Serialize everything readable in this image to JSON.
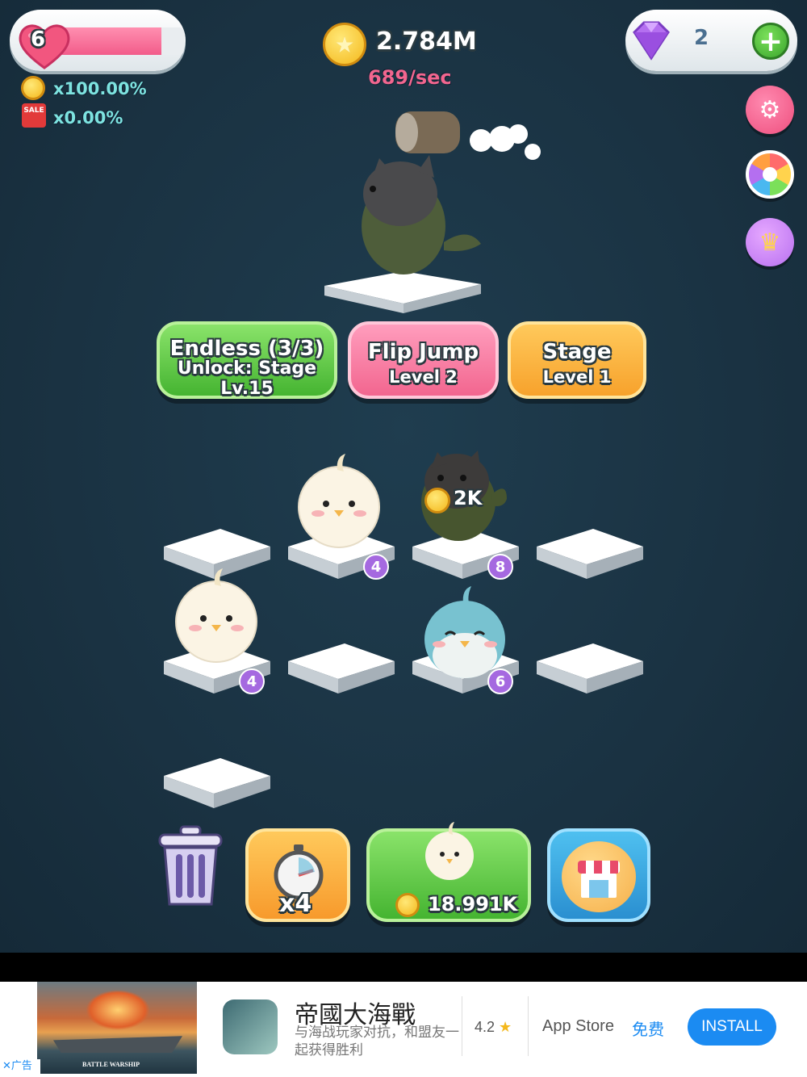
{
  "hud": {
    "lives": "6",
    "lives_fill": 0.82,
    "coins": "2.784M",
    "rate": "689/sec",
    "gems": "2",
    "coin_multiplier": "x100.00%",
    "sale_multiplier": "x0.00%",
    "sale_badge": "SALE"
  },
  "modes": {
    "endless": {
      "line1": "Endless (3/3)",
      "line2": "Unlock: Stage",
      "line3": "Lv.15"
    },
    "flip_jump": {
      "line1": "Flip Jump",
      "line2": "Level  2"
    },
    "stage": {
      "line1": "Stage",
      "line2": "Level 1"
    }
  },
  "board": {
    "chick_top_level": "4",
    "cat_fish_level": "8",
    "cat_fish_income": "2K",
    "chick_left_level": "4",
    "bluebird_level": "6"
  },
  "bottom": {
    "speed_label": "x4",
    "buy_price": "18.991K"
  },
  "ad": {
    "title": "帝國大海戰",
    "subtitle": "与海战玩家对抗，和盟友一起获得胜利",
    "rating": "4.2",
    "store": "App Store",
    "price": "免费",
    "install": "INSTALL",
    "ad_label": "广告",
    "banner_text": "BATTLE WARSHIP"
  },
  "colors": {
    "background": "#1b3444",
    "green": "#45b431",
    "pink": "#f2668f",
    "orange": "#f7a22c",
    "install_blue": "#1b8bf2",
    "rate_pink": "#f2668f"
  }
}
